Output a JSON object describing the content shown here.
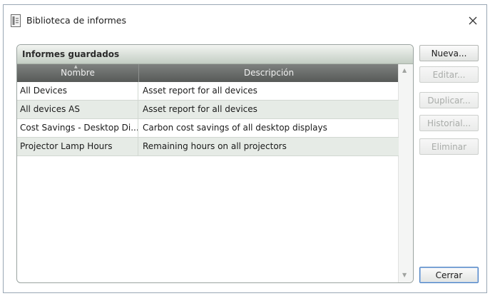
{
  "window": {
    "title": "Biblioteca de informes"
  },
  "panel": {
    "title": "Informes guardados",
    "columns": {
      "name": "Nombre",
      "description": "Descripción"
    },
    "rows": [
      {
        "name": "All Devices",
        "description": "Asset report for all devices"
      },
      {
        "name": "All devices AS",
        "description": "Asset report for all devices"
      },
      {
        "name": "Cost Savings - Desktop Di...",
        "description": "Carbon cost savings of all desktop displays"
      },
      {
        "name": "Projector Lamp Hours",
        "description": "Remaining hours on all projectors"
      }
    ]
  },
  "buttons": {
    "new": "Nueva...",
    "edit": "Editar...",
    "duplicate": "Duplicar...",
    "history": "Historial...",
    "delete": "Eliminar",
    "close": "Cerrar"
  },
  "icons": {
    "app": "report-library-icon",
    "close": "close-icon",
    "sort": "sort-ascending-icon",
    "scroll_up": "scroll-up-arrow-icon",
    "scroll_down": "scroll-down-arrow-icon"
  }
}
